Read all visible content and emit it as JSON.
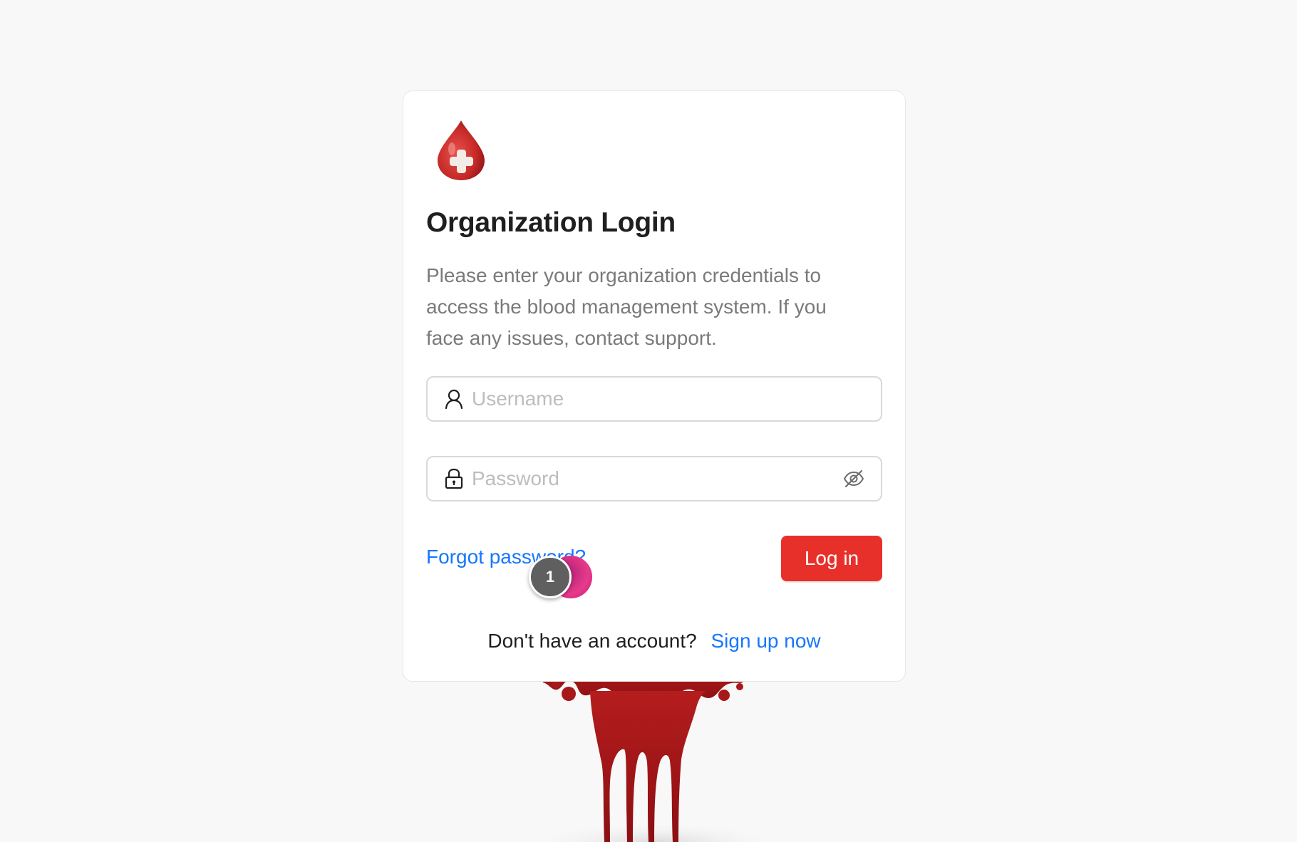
{
  "login": {
    "title": "Organization Login",
    "description": "Please enter your organization credentials to access the blood management system. If you face any issues, contact support.",
    "username": {
      "placeholder": "Username",
      "value": "",
      "icon": "user-icon"
    },
    "password": {
      "placeholder": "Password",
      "value": "",
      "icon": "lock-icon",
      "toggle_icon": "eye-invisible-icon"
    },
    "forgot_password_label": "Forgot password?",
    "login_button_label": "Log in",
    "signup_prompt": "Don't have an account?",
    "signup_link_label": "Sign up now"
  },
  "overlay": {
    "step_marker": "1"
  },
  "theme": {
    "background": "#f8f8f8",
    "primary_red": "#e8302a",
    "link_blue": "#1677ff",
    "text_dark": "#1f1f1f",
    "text_muted": "#7a7a7a",
    "border": "#d9d9d9"
  },
  "decor": {
    "logo": "blood-drop-plus-icon",
    "bottom_art": "dripping-blood-illustration"
  }
}
